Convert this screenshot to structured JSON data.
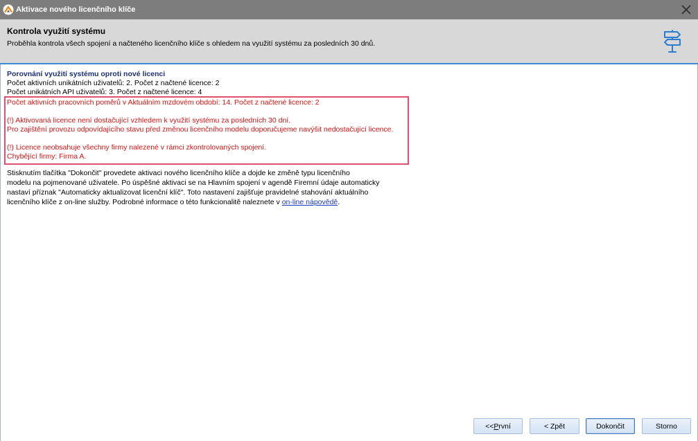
{
  "window": {
    "title": "Aktivace nového licenčního klíče",
    "logo_icon": "app-logo-icon",
    "close_icon": "close-icon"
  },
  "header": {
    "title": "Kontrola využití systému",
    "subtitle": "Proběhla kontrola všech spojení a načteného licenčního klíče s ohledem na využití systému za posledních 30 dnů.",
    "icon": "signpost-icon"
  },
  "content": {
    "section_title": "Porovnání využití systému oproti nové licenci",
    "usage_lines": [
      "Počet aktivních unikátních uživatelů: 2. Počet z načtené licence: 2",
      "Počet unikátních API uživatelů: 3. Počet z načtené licence: 4"
    ],
    "warning": {
      "usage_line": "Počet aktivních pracovních poměrů v Aktuálním mzdovém období: 14. Počet z načtené licence: 2",
      "insufficient_lines": [
        "(!) Aktivovaná licence není dostačující vzhledem k využití systému za posledních 30 dní.",
        "Pro zajištění provozu odpovídajícího stavu před změnou licenčního modelu doporučujeme navýšit nedostačující licence."
      ],
      "missing_lines": [
        "(!) Licence neobsahuje všechny firmy nalezené v rámci zkontrolovaných spojení.",
        "Chybějící firmy: Firma A."
      ]
    },
    "paragraph": {
      "lines": [
        "Stisknutím tlačítka \"Dokončit\" provedete aktivaci nového licenčního klíče a dojde ke změně typu licenčního",
        "modelu na pojmenované uživatele. Po úspěšné aktivaci se na Hlavním spojení v agendě Firemní údaje automaticky",
        "nastaví příznak \"Automaticky aktualizovat licenční klíč\". Toto nastavení zajišťuje pravidelné stahování aktuálního"
      ],
      "last_line_text": "licenčního klíče z on-line služby. Podrobné informace o této funkcionalitě naleznete v ",
      "link_text": "on-line nápovědě",
      "last_line_end": "."
    }
  },
  "buttons": {
    "first": {
      "prefix": "<< ",
      "accel": "P",
      "rest": "rvní"
    },
    "back": "< Zpět",
    "finish": "Dokončit",
    "cancel": "Storno"
  },
  "colors": {
    "accent": "#3a8ad4",
    "warn": "#e01010",
    "warn_border": "#e0506e",
    "link": "#1a37c4",
    "heading": "#1c2f7a",
    "titlebar": "#7d7d7d",
    "header": "#d8d8d8",
    "icon": "#2b7cd3"
  }
}
